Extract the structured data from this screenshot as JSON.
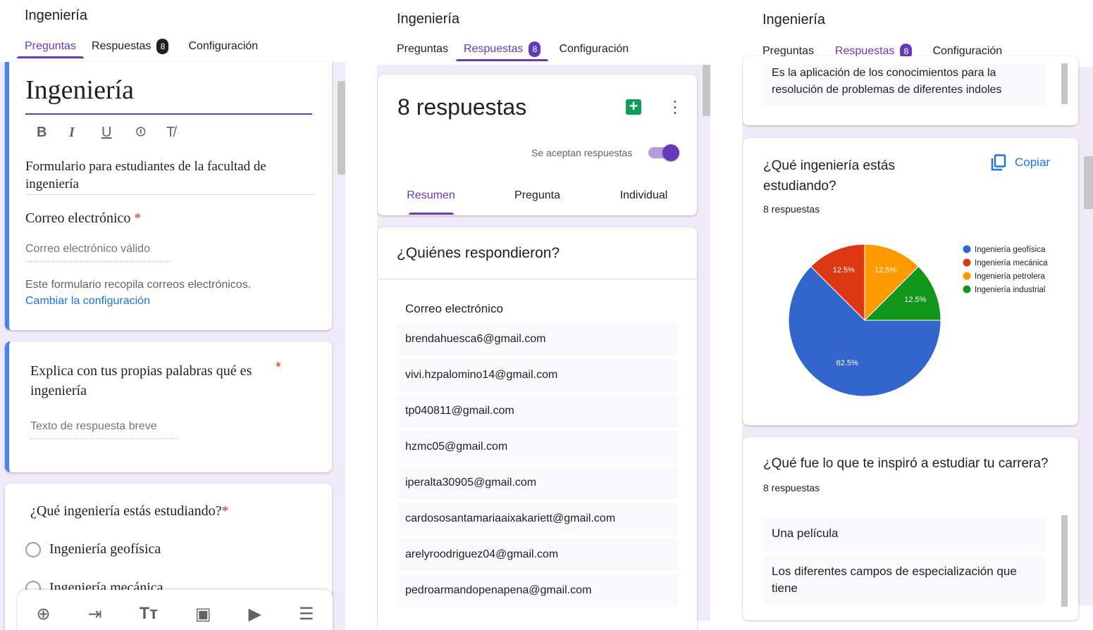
{
  "panel1": {
    "app_title": "Ingeniería",
    "tabs": [
      {
        "label": "Preguntas"
      },
      {
        "label": "Respuestas",
        "badge": "8"
      },
      {
        "label": "Configuración"
      }
    ],
    "form_title": "Ingeniería",
    "toolbar_icons": [
      "bold-icon",
      "italic-icon",
      "underline-icon",
      "link-icon",
      "clear-format-icon"
    ],
    "toolbar_glyphs": {
      "bold": "B",
      "italic": "I",
      "underline": "U",
      "link": "⊝",
      "clear": "T̸"
    },
    "description": "Formulario para estudiantes de la facultad de ingeniería",
    "email_label": "Correo electrónico",
    "required_mark": "*",
    "email_placeholder": "Correo electrónico válido",
    "email_notice": "Este formulario recopila correos electrónicos.",
    "email_notice_link": "Cambiar la configuración",
    "q1_title": "Explica con tus propias palabras qué es ingeniería",
    "q1_placeholder": "Texto de respuesta breve",
    "q2_title": "¿Qué ingeniería estás estudiando?",
    "q2_options": [
      "Ingeniería geofísica",
      "Ingeniería mecánica"
    ],
    "bottom_toolbar": [
      "add-question-icon",
      "import-questions-icon",
      "add-title-icon",
      "add-image-icon",
      "add-video-icon",
      "add-section-icon"
    ],
    "bottom_glyphs": {
      "add": "⊕",
      "import": "⇥",
      "title": "Tт",
      "image": "▣",
      "video": "▶",
      "section": "☰"
    }
  },
  "panel2": {
    "app_title": "Ingeniería",
    "tabs": [
      {
        "label": "Preguntas"
      },
      {
        "label": "Respuestas",
        "badge": "8"
      },
      {
        "label": "Configuración"
      }
    ],
    "responses_count": "8 respuestas",
    "sheets_glyph": "+",
    "more_glyph": "⋮",
    "accepting_label": "Se aceptan respuestas",
    "accepting": true,
    "sub_tabs": [
      "Resumen",
      "Pregunta",
      "Individual"
    ],
    "who_title": "¿Quiénes respondieron?",
    "email_header": "Correo electrónico",
    "emails": [
      "brendahuesca6@gmail.com",
      "vivi.hzpalomino14@gmail.com",
      "tp040811@gmail.com",
      "hzmc05@gmail.com",
      "iperalta30905@gmail.com",
      "cardososantamariaaixakariett@gmail.com",
      "arelyroodriguez04@gmail.com",
      "pedroarmandopenapena@gmail.com"
    ]
  },
  "panel3": {
    "app_title": "Ingeniería",
    "tabs": [
      {
        "label": "Preguntas"
      },
      {
        "label": "Respuestas",
        "badge": "8"
      },
      {
        "label": "Configuración"
      }
    ],
    "prev_answer": "Es la aplicación de los conocimientos para la resolución de problemas de diferentes indoles",
    "q2_title": "¿Qué ingeniería estás estudiando?",
    "copy_label": "Copiar",
    "q2_count": "8 respuestas",
    "q3_title": "¿Qué fue lo que te inspiró a estudiar tu carrera?",
    "q3_count": "8 respuestas",
    "q3_answers": [
      "Una película",
      "Los diferentes campos de especialización que tiene"
    ]
  },
  "chart_data": {
    "type": "pie",
    "categories": [
      "Ingeniería geofísica",
      "Ingeniería mecánica",
      "Ingeniería petrolera",
      "Ingeniería industrial"
    ],
    "values": [
      62.5,
      12.5,
      12.5,
      12.5
    ],
    "labels": [
      "62.5%",
      "12.5%",
      "12.5%",
      "12.5%"
    ],
    "colors": [
      "#3366cc",
      "#dc3912",
      "#ff9900",
      "#109618"
    ],
    "legend": "right"
  }
}
